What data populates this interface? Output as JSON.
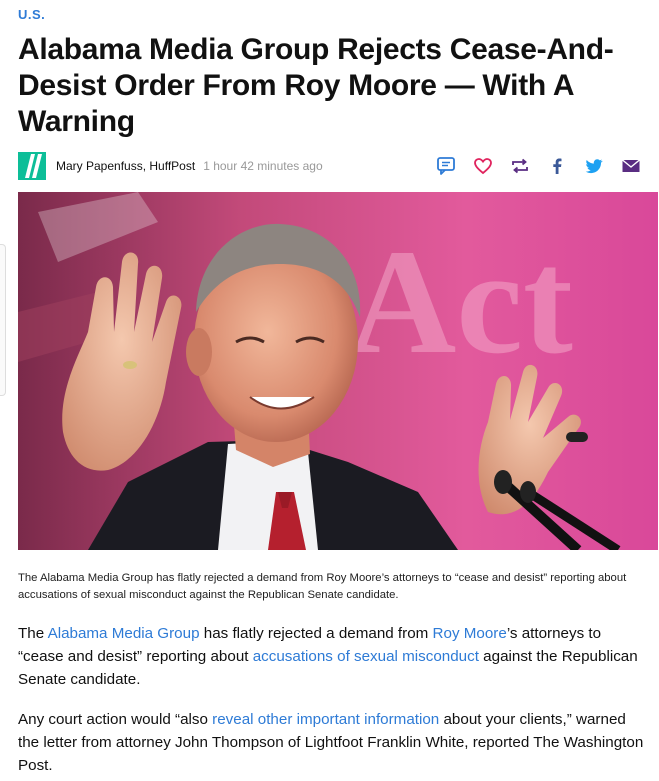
{
  "section": {
    "label": "U.S."
  },
  "article": {
    "headline": "Alabama Media Group Rejects Cease-And-Desist Order From Roy Moore — With A Warning",
    "byline": {
      "author": "Mary Papenfuss,",
      "outlet": "HuffPost",
      "timestamp": "1 hour 42 minutes ago"
    },
    "caption": "The Alabama Media Group has flatly rejected a demand from Roy Moore’s attorneys to “cease and desist” reporting about accusations of sexual misconduct against the Republican Senate candidate.",
    "paragraph1": {
      "t1": "The ",
      "link1": "Alabama Media Group",
      "t2": " has flatly rejected a demand from ",
      "link2": "Roy Moore",
      "t3": "’s attorneys to “cease and desist” reporting about ",
      "link3": "accusations of sexual misconduct",
      "t4": " against the Republican Senate candidate."
    },
    "paragraph2": {
      "t1": "Any court action would “also ",
      "link1": "reveal other important information",
      "t2": " about your clients,” warned the letter from attorney John Thompson of Lightfoot Franklin White, reported The Washington Post."
    }
  },
  "share_icons": [
    "comment-icon",
    "heart-icon",
    "repost-icon",
    "facebook-icon",
    "twitter-icon",
    "email-icon"
  ],
  "colors": {
    "link": "#2e7bd6",
    "brand_green": "#0dbe98",
    "heart_red": "#e0245e",
    "facebook_blue": "#3b5998",
    "twitter_blue": "#1da1f2",
    "email_purple": "#5a2d82"
  }
}
